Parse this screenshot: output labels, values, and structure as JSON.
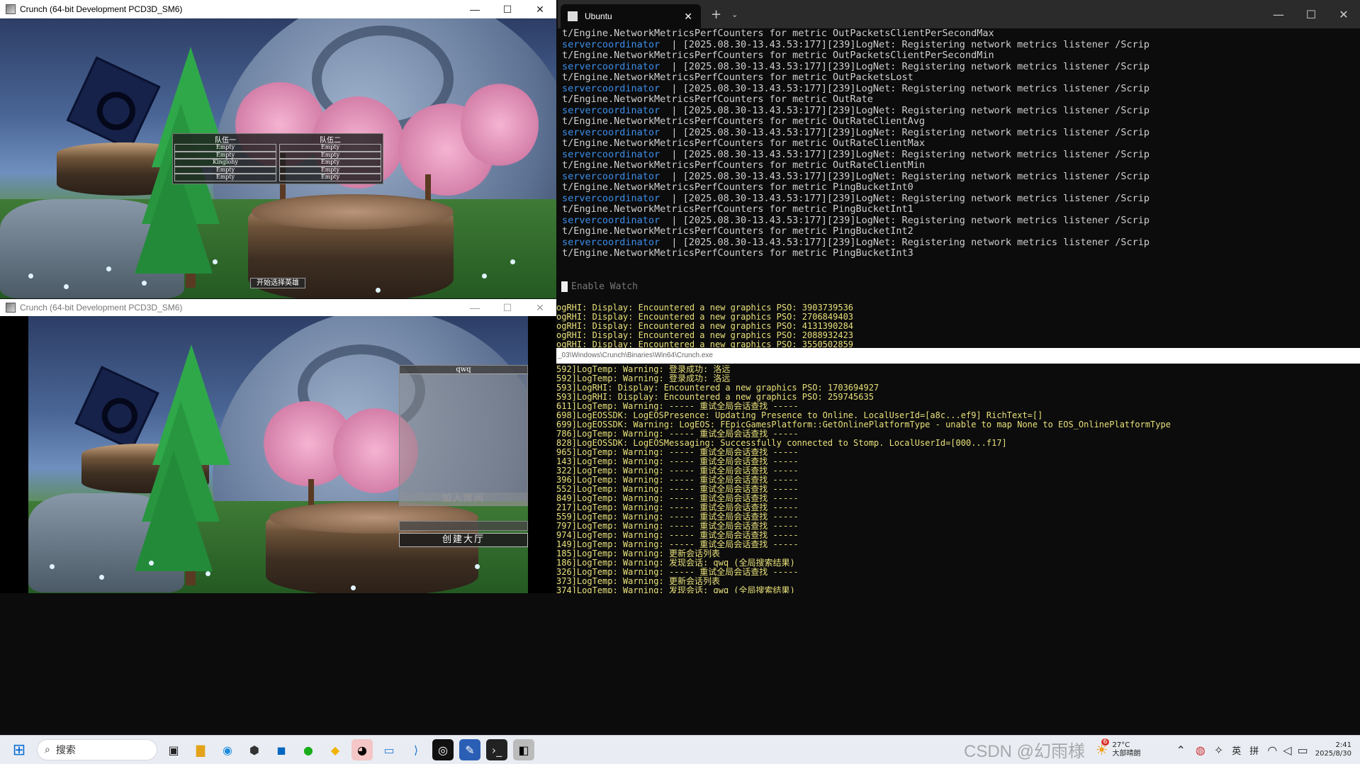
{
  "game_top": {
    "title": "Crunch (64-bit Development PCD3D_SM6)",
    "table": {
      "col1": "队伍一",
      "col2": "队伍二",
      "rows": [
        [
          "Empty",
          "Empty"
        ],
        [
          "Empty",
          "Empty"
        ],
        [
          "Kinglohy",
          "Empty"
        ],
        [
          "Empty",
          "Empty"
        ],
        [
          "Empty",
          "Empty"
        ]
      ]
    },
    "button": "开始选择英雄"
  },
  "game_bottom": {
    "title": "Crunch (64-bit Development PCD3D_SM6)",
    "session_name": "qwq",
    "join_button": "加入房间",
    "create_button": "创建大厅"
  },
  "ubuntu": {
    "tab_title": "Ubuntu",
    "lines": [
      {
        "svc": "",
        "text": "t/Engine.NetworkMetricsPerfCounters for metric OutPacketsClientPerSecondMax"
      },
      {
        "svc": "servercoordinator",
        "text": "  | [2025.08.30-13.43.53:177][239]LogNet: Registering network metrics listener /Scrip"
      },
      {
        "svc": "",
        "text": "t/Engine.NetworkMetricsPerfCounters for metric OutPacketsClientPerSecondMin"
      },
      {
        "svc": "servercoordinator",
        "text": "  | [2025.08.30-13.43.53:177][239]LogNet: Registering network metrics listener /Scrip"
      },
      {
        "svc": "",
        "text": "t/Engine.NetworkMetricsPerfCounters for metric OutPacketsLost"
      },
      {
        "svc": "servercoordinator",
        "text": "  | [2025.08.30-13.43.53:177][239]LogNet: Registering network metrics listener /Scrip"
      },
      {
        "svc": "",
        "text": "t/Engine.NetworkMetricsPerfCounters for metric OutRate"
      },
      {
        "svc": "servercoordinator",
        "text": "  | [2025.08.30-13.43.53:177][239]LogNet: Registering network metrics listener /Scrip"
      },
      {
        "svc": "",
        "text": "t/Engine.NetworkMetricsPerfCounters for metric OutRateClientAvg"
      },
      {
        "svc": "servercoordinator",
        "text": "  | [2025.08.30-13.43.53:177][239]LogNet: Registering network metrics listener /Scrip"
      },
      {
        "svc": "",
        "text": "t/Engine.NetworkMetricsPerfCounters for metric OutRateClientMax"
      },
      {
        "svc": "servercoordinator",
        "text": "  | [2025.08.30-13.43.53:177][239]LogNet: Registering network metrics listener /Scrip"
      },
      {
        "svc": "",
        "text": "t/Engine.NetworkMetricsPerfCounters for metric OutRateClientMin"
      },
      {
        "svc": "servercoordinator",
        "text": "  | [2025.08.30-13.43.53:177][239]LogNet: Registering network metrics listener /Scrip"
      },
      {
        "svc": "",
        "text": "t/Engine.NetworkMetricsPerfCounters for metric PingBucketInt0"
      },
      {
        "svc": "servercoordinator",
        "text": "  | [2025.08.30-13.43.53:177][239]LogNet: Registering network metrics listener /Scrip"
      },
      {
        "svc": "",
        "text": "t/Engine.NetworkMetricsPerfCounters for metric PingBucketInt1"
      },
      {
        "svc": "servercoordinator",
        "text": "  | [2025.08.30-13.43.53:177][239]LogNet: Registering network metrics listener /Scrip"
      },
      {
        "svc": "",
        "text": "t/Engine.NetworkMetricsPerfCounters for metric PingBucketInt2"
      },
      {
        "svc": "servercoordinator",
        "text": "  | [2025.08.30-13.43.53:177][239]LogNet: Registering network metrics listener /Scrip"
      },
      {
        "svc": "",
        "text": "t/Engine.NetworkMetricsPerfCounters for metric PingBucketInt3"
      }
    ],
    "watch_label": "Enable Watch"
  },
  "rhi_log": {
    "lines": [
      "ogRHI: Display: Encountered a new graphics PSO: 3903739536",
      "ogRHI: Display: Encountered a new graphics PSO: 2706849403",
      "ogRHI: Display: Encountered a new graphics PSO: 4131390284",
      "ogRHI: Display: Encountered a new graphics PSO: 2088932423",
      "ogRHI: Display: Encountered a new graphics PSO: 3550502859"
    ]
  },
  "crunch_log": {
    "path": "_03\\Windows\\Crunch\\Binaries\\Win64\\Crunch.exe",
    "lines": [
      "592]LogTemp: Warning: 登录成功: 洛远",
      "592]LogTemp: Warning: 登录成功: 洛远",
      "593]LogRHI: Display: Encountered a new graphics PSO: 1703694927",
      "593]LogRHI: Display: Encountered a new graphics PSO: 259745635",
      "611]LogTemp: Warning: ----- 重试全局会话查找 -----",
      "698]LogEOSSDK: LogEOSPresence: Updating Presence to Online. LocalUserId=[a8c...ef9] RichText=[]",
      "699]LogEOSSDK: Warning: LogEOS: FEpicGamesPlatform::GetOnlinePlatformType - unable to map None to EOS_OnlinePlatformType",
      "786]LogTemp: Warning: ----- 重试全局会话查找 -----",
      "828]LogEOSSDK: LogEOSMessaging: Successfully connected to Stomp. LocalUserId=[000...f17]",
      "965]LogTemp: Warning: ----- 重试全局会话查找 -----",
      "143]LogTemp: Warning: ----- 重试全局会话查找 -----",
      "322]LogTemp: Warning: ----- 重试全局会话查找 -----",
      "396]LogTemp: Warning: ----- 重试全局会话查找 -----",
      "552]LogTemp: Warning: ----- 重试全局会话查找 -----",
      "849]LogTemp: Warning: ----- 重试全局会话查找 -----",
      "217]LogTemp: Warning: ----- 重试全局会话查找 -----",
      "559]LogTemp: Warning: ----- 重试全局会话查找 -----",
      "797]LogTemp: Warning: ----- 重试全局会话查找 -----",
      "974]LogTemp: Warning: ----- 重试全局会话查找 -----",
      "149]LogTemp: Warning: ----- 重试全局会话查找 -----",
      "185]LogTemp: Warning: 更新会话列表",
      "186]LogTemp: Warning: 发现会话: qwq (全局搜索结果)",
      "326]LogTemp: Warning: ----- 重试全局会话查找 -----",
      "373]LogTemp: Warning: 更新会话列表",
      "374]LogTemp: Warning: 发现会话: qwq (全局搜索结果)"
    ]
  },
  "taskbar": {
    "search_placeholder": "搜索",
    "weather_temp": "27°C",
    "weather_desc": "大部晴朗",
    "weather_badge": "6",
    "ime": "英",
    "ime2": "拼",
    "time": "2:41",
    "date": "2025/8/30",
    "watermark": "CSDN @幻雨様"
  }
}
